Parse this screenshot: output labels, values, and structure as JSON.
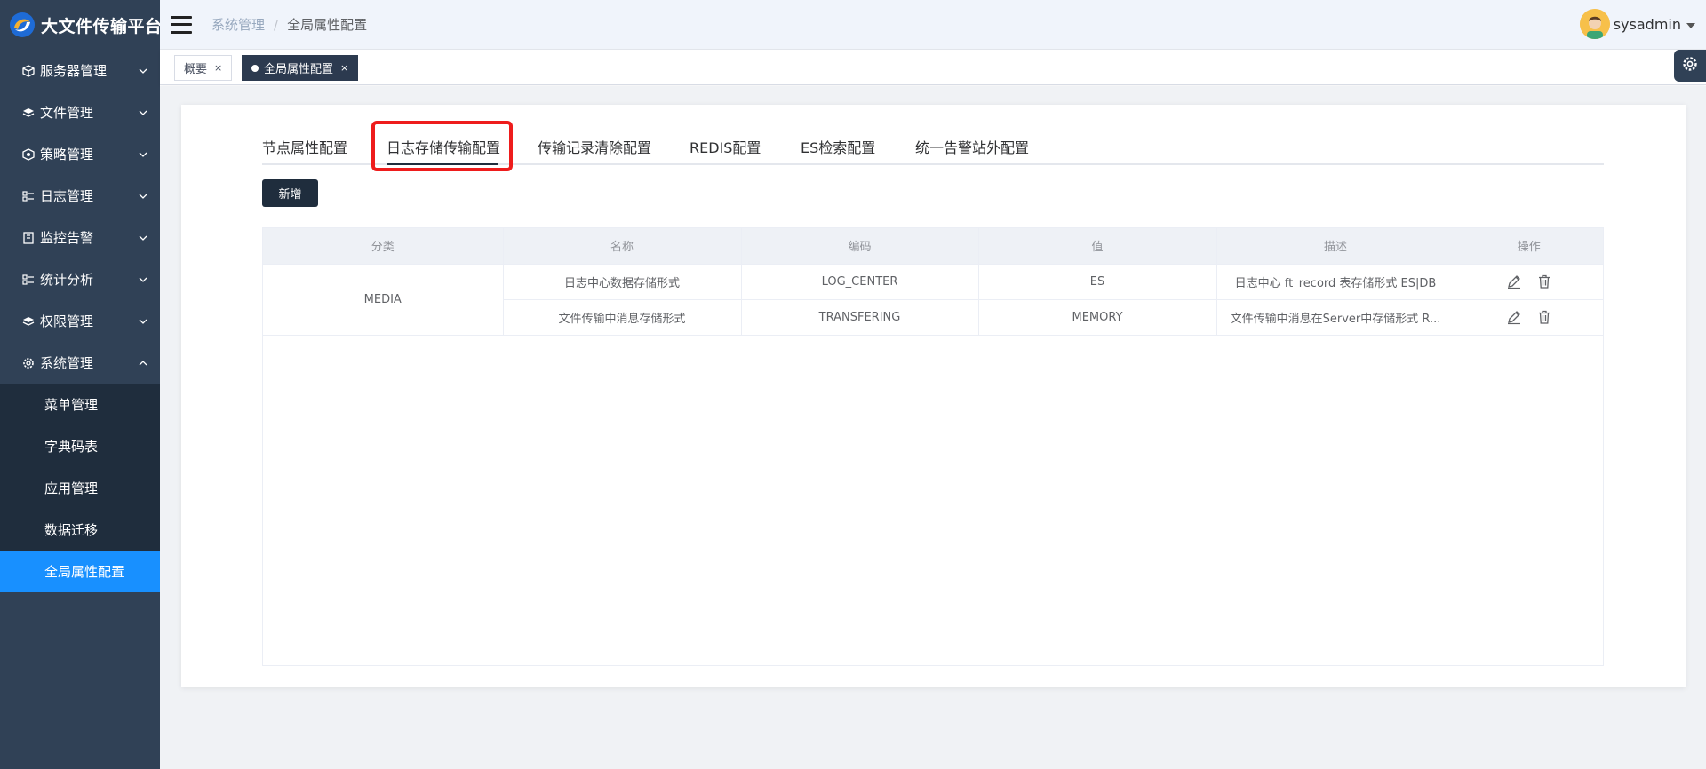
{
  "app": {
    "title": "大文件传输平台"
  },
  "sidebar": {
    "items": [
      {
        "label": "服务器管理",
        "icon": "box-icon"
      },
      {
        "label": "文件管理",
        "icon": "layers-icon"
      },
      {
        "label": "策略管理",
        "icon": "policy-icon"
      },
      {
        "label": "日志管理",
        "icon": "list-icon"
      },
      {
        "label": "监控告警",
        "icon": "monitor-icon"
      },
      {
        "label": "统计分析",
        "icon": "chart-icon"
      },
      {
        "label": "权限管理",
        "icon": "layers-icon"
      },
      {
        "label": "系统管理",
        "icon": "gear-icon"
      }
    ],
    "sub_items": [
      {
        "label": "菜单管理"
      },
      {
        "label": "字典码表"
      },
      {
        "label": "应用管理"
      },
      {
        "label": "数据迁移"
      },
      {
        "label": "全局属性配置",
        "active": true
      }
    ]
  },
  "navbar": {
    "breadcrumb": [
      "系统管理",
      "全局属性配置"
    ],
    "separator": "/",
    "username": "sysadmin"
  },
  "tags": [
    {
      "label": "概要",
      "close": "×"
    },
    {
      "label": "全局属性配置",
      "close": "×",
      "active": true
    }
  ],
  "tabs": [
    {
      "label": "节点属性配置"
    },
    {
      "label": "日志存储传输配置",
      "active": true
    },
    {
      "label": "传输记录清除配置"
    },
    {
      "label": "REDIS配置"
    },
    {
      "label": "ES检索配置"
    },
    {
      "label": "统一告警站外配置"
    }
  ],
  "toolbar": {
    "add_label": "新增"
  },
  "table": {
    "headers": [
      "分类",
      "名称",
      "编码",
      "值",
      "描述",
      "操作"
    ],
    "group": "MEDIA",
    "rows": [
      {
        "name": "日志中心数据存储形式",
        "code": "LOG_CENTER",
        "value": "ES",
        "desc": "日志中心 ft_record 表存储形式 ES|DB"
      },
      {
        "name": "文件传输中消息存储形式",
        "code": "TRANSFERING",
        "value": "MEMORY",
        "desc": "文件传输中消息在Server中存储形式 R..."
      }
    ]
  },
  "colors": {
    "sidebar_bg": "#304156",
    "sidebar_active": "#1890ff",
    "highlight": "#ee1c1c",
    "primary_dark": "#1f2d3d"
  }
}
